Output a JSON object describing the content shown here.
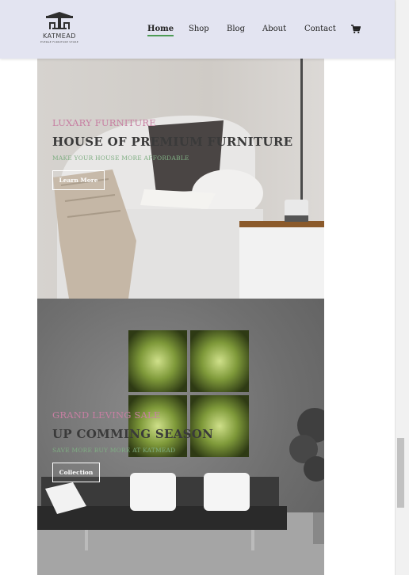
{
  "brand": {
    "name": "KATMEAD",
    "tagline": "EVERGE FURNITURE STORE"
  },
  "nav": {
    "items": [
      "Home",
      "Shop",
      "Blog",
      "About",
      "Contact"
    ],
    "active": "Home",
    "cart_icon": "cart-icon"
  },
  "hero1": {
    "eyebrow": "LUXARY FURNITURE",
    "headline": "HOUSE OF PREMIUM FURNITURE",
    "subline": "MAKE YOUR HOUSE MORE AFFORDABLE",
    "button": "Learn More"
  },
  "hero2": {
    "eyebrow": "GRAND LEVING SALE",
    "headline": "UP COMMING SEASON",
    "subline": "SAVE MORE BUY MORE AT KATMEAD",
    "button": "Collection"
  },
  "colors": {
    "header_bg": "#e3e4f1",
    "active_underline": "#4d9b55",
    "eyebrow": "#c77fa2",
    "subline": "#7fae83"
  }
}
